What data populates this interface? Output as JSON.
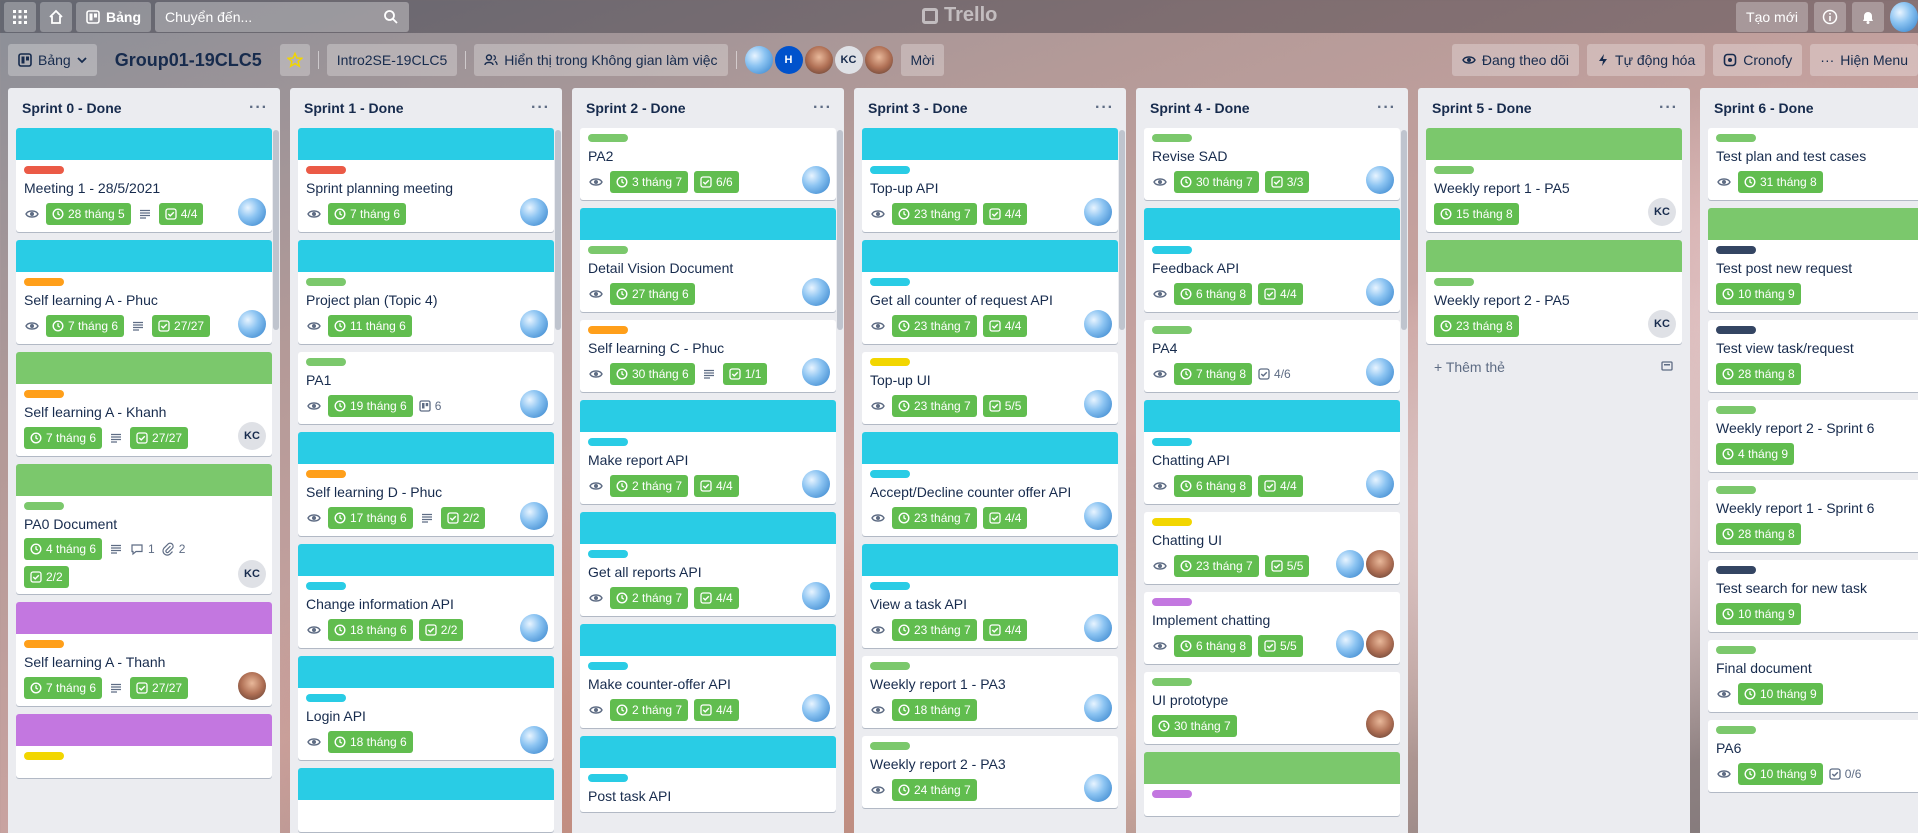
{
  "header": {
    "board_button": "Bảng",
    "search_placeholder": "Chuyển đến...",
    "logo": "Trello",
    "create": "Tạo mới"
  },
  "board": {
    "view_label": "Bảng",
    "title": "Group01-19CLC5",
    "workspace": "Intro2SE-19CLC5",
    "visibility": "Hiển thị trong Không gian làm việc",
    "members": [
      {
        "type": "globe",
        "text": ""
      },
      {
        "type": "h",
        "text": "H"
      },
      {
        "type": "photo",
        "text": ""
      },
      {
        "type": "kc",
        "text": "KC"
      },
      {
        "type": "photo",
        "text": ""
      }
    ],
    "invite": "Mời",
    "watching": "Đang theo dõi",
    "automation": "Tự động hóa",
    "cronofy": "Cronofy",
    "show_menu": "Hiện Menu"
  },
  "lists": [
    {
      "title": "Sprint 0 - Done",
      "cards": [
        {
          "cover": "cyan",
          "label": "red",
          "title": "Meeting 1 - 28/5/2021",
          "eye": true,
          "due": "28 tháng 5",
          "desc": true,
          "check": "4/4",
          "members": [
            "globe"
          ]
        },
        {
          "cover": "cyan",
          "label": "orange",
          "title": "Self learning A - Phuc",
          "eye": true,
          "due": "7 tháng 6",
          "desc": true,
          "check": "27/27",
          "members": [
            "globe"
          ]
        },
        {
          "cover": "lgreen",
          "label": "orange",
          "title": "Self learning A - Khanh",
          "eye": false,
          "due": "7 tháng 6",
          "desc": true,
          "check": "27/27",
          "members": [
            "kc"
          ]
        },
        {
          "cover": "lgreen",
          "label": "lgreen",
          "title": "PA0 Document",
          "eye": false,
          "due": "4 tháng 6",
          "desc": true,
          "comments": "1",
          "attach": "2",
          "check": "2/2",
          "members": [
            "kc"
          ]
        },
        {
          "cover": "purple",
          "label": "orange",
          "title": "Self learning A - Thanh",
          "eye": false,
          "due": "7 tháng 6",
          "desc": true,
          "check": "27/27",
          "members": [
            "photo"
          ]
        },
        {
          "cover": "purple",
          "label": "yellow",
          "title": "",
          "eye": false,
          "members": []
        }
      ]
    },
    {
      "title": "Sprint 1 - Done",
      "cards": [
        {
          "cover": "cyan",
          "label": "red",
          "title": "Sprint planning meeting",
          "eye": true,
          "due": "7 tháng 6",
          "members": [
            "globe"
          ]
        },
        {
          "cover": "cyan",
          "label": "lgreen",
          "title": "Project plan (Topic 4)",
          "eye": true,
          "due": "11 tháng 6",
          "members": [
            "globe"
          ]
        },
        {
          "cover": "",
          "label": "lgreen",
          "title": "PA1",
          "eye": true,
          "due": "19 tháng 6",
          "board": "6",
          "members": [
            "globe"
          ]
        },
        {
          "cover": "cyan",
          "label": "orange",
          "title": "Self learning D - Phuc",
          "eye": true,
          "due": "17 tháng 6",
          "desc": true,
          "check": "2/2",
          "members": [
            "globe"
          ]
        },
        {
          "cover": "cyan",
          "label": "cyan",
          "title": "Change information API",
          "eye": true,
          "due": "18 tháng 6",
          "check": "2/2",
          "members": [
            "globe"
          ]
        },
        {
          "cover": "cyan",
          "label": "cyan",
          "title": "Login API",
          "eye": true,
          "due": "18 tháng 6",
          "members": [
            "globe"
          ]
        },
        {
          "cover": "cyan",
          "label": "",
          "title": "",
          "eye": false,
          "members": []
        }
      ]
    },
    {
      "title": "Sprint 2 - Done",
      "cards": [
        {
          "cover": "",
          "label": "lgreen",
          "title": "PA2",
          "eye": true,
          "due": "3 tháng 7",
          "check": "6/6",
          "members": [
            "globe"
          ]
        },
        {
          "cover": "cyan",
          "label": "lgreen",
          "title": "Detail Vision Document",
          "eye": true,
          "due": "27 tháng 6",
          "members": [
            "globe"
          ]
        },
        {
          "cover": "",
          "label": "orange",
          "title": "Self learning C - Phuc",
          "eye": true,
          "due": "30 tháng 6",
          "desc": true,
          "check": "1/1",
          "members": [
            "globe"
          ]
        },
        {
          "cover": "cyan",
          "label": "cyan",
          "title": "Make report API",
          "eye": true,
          "due": "2 tháng 7",
          "check": "4/4",
          "members": [
            "globe"
          ]
        },
        {
          "cover": "cyan",
          "label": "cyan",
          "title": "Get all reports API",
          "eye": true,
          "due": "2 tháng 7",
          "check": "4/4",
          "members": [
            "globe"
          ]
        },
        {
          "cover": "cyan",
          "label": "cyan",
          "title": "Make counter-offer API",
          "eye": true,
          "due": "2 tháng 7",
          "check": "4/4",
          "members": [
            "globe"
          ]
        },
        {
          "cover": "cyan",
          "label": "cyan",
          "title": "Post task API",
          "eye": false,
          "members": []
        }
      ]
    },
    {
      "title": "Sprint 3 - Done",
      "cards": [
        {
          "cover": "cyan",
          "label": "cyan",
          "title": "Top-up API",
          "eye": true,
          "due": "23 tháng 7",
          "check": "4/4",
          "members": [
            "globe"
          ]
        },
        {
          "cover": "cyan",
          "label": "cyan",
          "title": "Get all counter of request API",
          "eye": true,
          "due": "23 tháng 7",
          "check": "4/4",
          "members": [
            "globe"
          ]
        },
        {
          "cover": "",
          "label": "yellow",
          "title": "Top-up UI",
          "eye": true,
          "due": "23 tháng 7",
          "check": "5/5",
          "members": [
            "globe"
          ]
        },
        {
          "cover": "cyan",
          "label": "cyan",
          "title": "Accept/Decline counter offer API",
          "eye": true,
          "due": "23 tháng 7",
          "check": "4/4",
          "members": [
            "globe"
          ]
        },
        {
          "cover": "cyan",
          "label": "cyan",
          "title": "View a task API",
          "eye": true,
          "due": "23 tháng 7",
          "check": "4/4",
          "members": [
            "globe"
          ]
        },
        {
          "cover": "",
          "label": "lgreen",
          "title": "Weekly report 1 - PA3",
          "eye": true,
          "due": "18 tháng 7",
          "members": [
            "globe"
          ]
        },
        {
          "cover": "",
          "label": "lgreen",
          "title": "Weekly report 2 - PA3",
          "eye": true,
          "due": "24 tháng 7",
          "members": [
            "globe"
          ]
        }
      ]
    },
    {
      "title": "Sprint 4 - Done",
      "cards": [
        {
          "cover": "",
          "label": "lgreen",
          "title": "Revise SAD",
          "eye": true,
          "due": "30 tháng 7",
          "check": "3/3",
          "members": [
            "globe"
          ]
        },
        {
          "cover": "cyan",
          "label": "cyan",
          "title": "Feedback API",
          "eye": true,
          "due": "6 tháng 8",
          "check": "4/4",
          "members": [
            "globe"
          ]
        },
        {
          "cover": "",
          "label": "lgreen",
          "title": "PA4",
          "eye": true,
          "due": "7 tháng 8",
          "checkplain": "4/6",
          "members": [
            "globe"
          ]
        },
        {
          "cover": "cyan",
          "label": "cyan",
          "title": "Chatting API",
          "eye": true,
          "due": "6 tháng 8",
          "check": "4/4",
          "members": [
            "globe"
          ]
        },
        {
          "cover": "",
          "label": "yellow",
          "title": "Chatting UI",
          "eye": true,
          "due": "23 tháng 7",
          "check": "5/5",
          "members": [
            "globe",
            "photo"
          ]
        },
        {
          "cover": "",
          "label": "purple",
          "title": "Implement chatting",
          "eye": true,
          "due": "6 tháng 8",
          "check": "5/5",
          "members": [
            "globe",
            "photo"
          ]
        },
        {
          "cover": "",
          "label": "lgreen",
          "title": "UI prototype",
          "eye": false,
          "due": "30 tháng 7",
          "members": [
            "photo"
          ]
        },
        {
          "cover": "lgreen",
          "label": "purple",
          "title": "",
          "eye": false,
          "members": []
        }
      ]
    },
    {
      "title": "Sprint 5 - Done",
      "add_card": "Thêm thẻ",
      "cards": [
        {
          "cover": "lgreen",
          "label": "lgreen",
          "title": "Weekly report 1 - PA5",
          "eye": false,
          "due": "15 tháng 8",
          "members": [
            "kc"
          ]
        },
        {
          "cover": "lgreen",
          "label": "lgreen",
          "title": "Weekly report 2 - PA5",
          "eye": false,
          "due": "23 tháng 8",
          "members": [
            "kc"
          ]
        }
      ]
    },
    {
      "title": "Sprint 6 - Done",
      "cards": [
        {
          "cover": "",
          "label": "lgreen",
          "title": "Test plan and test cases",
          "eye": true,
          "due": "31 tháng 8",
          "members": []
        },
        {
          "cover": "lgreen",
          "label": "navy",
          "title": "Test post new request",
          "eye": false,
          "due": "10 tháng 9",
          "members": []
        },
        {
          "cover": "",
          "label": "navy",
          "title": "Test view task/request",
          "eye": false,
          "due": "28 tháng 8",
          "members": []
        },
        {
          "cover": "",
          "label": "lgreen",
          "title": "Weekly report 2 - Sprint 6",
          "eye": false,
          "due": "4 tháng 9",
          "members": []
        },
        {
          "cover": "",
          "label": "lgreen",
          "title": "Weekly report 1 - Sprint 6",
          "eye": false,
          "due": "28 tháng 8",
          "members": []
        },
        {
          "cover": "",
          "label": "navy",
          "title": "Test search for new task",
          "eye": false,
          "due": "10 tháng 9",
          "members": []
        },
        {
          "cover": "",
          "label": "lgreen",
          "title": "Final document",
          "eye": true,
          "due": "10 tháng 9",
          "members": []
        },
        {
          "cover": "",
          "label": "lgreen",
          "title": "PA6",
          "eye": true,
          "due": "10 tháng 9",
          "checkplain": "0/6",
          "members": []
        }
      ]
    }
  ]
}
